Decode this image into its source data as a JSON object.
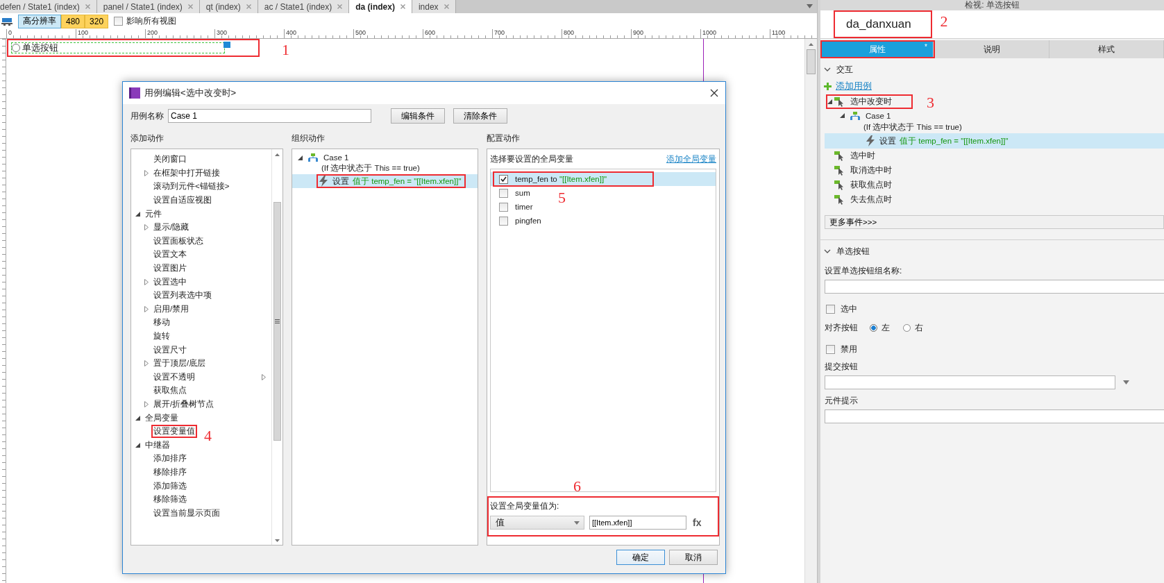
{
  "editor_tabs": [
    {
      "label": "defen / State1 (index)",
      "selected": false
    },
    {
      "label": "panel / State1 (index)",
      "selected": false
    },
    {
      "label": "qt (index)",
      "selected": false
    },
    {
      "label": "ac / State1 (index)",
      "selected": false
    },
    {
      "label": "da (index)",
      "selected": true
    },
    {
      "label": "index",
      "selected": false
    }
  ],
  "toolbar": {
    "views": [
      {
        "label": "高分辨率",
        "kind": "base",
        "selected": true
      },
      {
        "label": "480",
        "kind": "breakpoint",
        "selected": false
      },
      {
        "label": "320",
        "kind": "breakpoint",
        "selected": false
      }
    ],
    "affect_all": {
      "label": "影响所有视图",
      "checked": false
    }
  },
  "ruler": {
    "labels": [
      "0",
      "100",
      "200",
      "300",
      "400",
      "500",
      "600",
      "700",
      "800",
      "900",
      "1000",
      "1100"
    ]
  },
  "canvas": {
    "widget": {
      "label": "单选按钮",
      "selected": false,
      "callout": "1"
    }
  },
  "dialog": {
    "title": "用例编辑<选中改变时>",
    "case_name": {
      "label": "用例名称",
      "value": "Case 1"
    },
    "buttons": [
      "编辑条件",
      "清除条件"
    ],
    "add_actions": {
      "heading": "添加动作",
      "tree": [
        {
          "children": [
            {
              "label": "关闭窗口"
            },
            {
              "label": "在框架中打开链接",
              "expanded": false
            },
            {
              "label": "滚动到元件<锚链接>"
            },
            {
              "label": "设置自适应视图"
            }
          ]
        },
        {
          "label": "元件",
          "expanded": true,
          "children": [
            {
              "label": "显示/隐藏",
              "expanded": false
            },
            {
              "label": "设置面板状态"
            },
            {
              "label": "设置文本"
            },
            {
              "label": "设置图片"
            },
            {
              "label": "设置选中",
              "expanded": false
            },
            {
              "label": "设置列表选中项"
            },
            {
              "label": "启用/禁用",
              "expanded": false
            },
            {
              "label": "移动"
            },
            {
              "label": "旋转"
            },
            {
              "label": "设置尺寸"
            },
            {
              "label": "置于顶层/底层",
              "expanded": false
            },
            {
              "label": "设置不透明",
              "submenu": true
            },
            {
              "label": "获取焦点"
            },
            {
              "label": "展开/折叠树节点",
              "expanded": false
            }
          ]
        },
        {
          "label": "全局变量",
          "expanded": true,
          "children": [
            {
              "label": "设置变量值",
              "callout": "4"
            }
          ]
        },
        {
          "label": "中继器",
          "expanded": true,
          "children": [
            {
              "label": "添加排序"
            },
            {
              "label": "移除排序"
            },
            {
              "label": "添加筛选"
            },
            {
              "label": "移除筛选"
            },
            {
              "label": "设置当前显示页面"
            }
          ]
        }
      ]
    },
    "organize": {
      "heading": "组织动作",
      "cases": [
        {
          "label": "Case 1",
          "condition": "(If 选中状态于 This == true)",
          "expanded": true,
          "actions": [
            {
              "verb": "设置",
              "detail": "值于 temp_fen = \"[[Item.xfen]]\"",
              "selected": true,
              "boxed": true
            }
          ]
        }
      ]
    },
    "configure": {
      "heading": "配置动作",
      "prompt": "选择要设置的全局变量",
      "add_link": "添加全局变量",
      "variables": [
        {
          "name": "temp_fen to",
          "value": "\"[[Item.xfen]]\"",
          "checked": true,
          "selected": true,
          "callout": "5"
        },
        {
          "name": "sum",
          "checked": false,
          "selected": false
        },
        {
          "name": "timer",
          "checked": false,
          "selected": false
        },
        {
          "name": "pingfen",
          "checked": false,
          "selected": false
        }
      ],
      "value_section": {
        "label": "设置全局变量值为:",
        "type": "值",
        "value": "[[Item.xfen]]",
        "fx": "fx",
        "callout": "6"
      }
    },
    "footer_buttons": [
      {
        "label": "确定",
        "kind": "primary"
      },
      {
        "label": "取消",
        "kind": "normal"
      }
    ]
  },
  "inspector": {
    "title": "检视: 单选按钮",
    "name": {
      "value": "da_danxuan",
      "callout": "2"
    },
    "tabs": [
      {
        "label": "属性",
        "selected": true,
        "marker": "*",
        "boxed": true
      },
      {
        "label": "说明",
        "selected": false
      },
      {
        "label": "样式",
        "selected": false
      }
    ],
    "interaction": {
      "heading": "交互",
      "expanded": true,
      "add_case": "添加用例",
      "events": [
        {
          "label": "选中改变时",
          "expanded": true,
          "callout": "3",
          "cases": [
            {
              "label": "Case 1",
              "condition": "(If 选中状态于 This == true)",
              "expanded": true,
              "actions": [
                {
                  "verb": "设置",
                  "detail": "值于 temp_fen = \"[[Item.xfen]]\"",
                  "selected": true
                }
              ]
            }
          ]
        },
        {
          "label": "选中时"
        },
        {
          "label": "取消选中时"
        },
        {
          "label": "获取焦点时"
        },
        {
          "label": "失去焦点时"
        }
      ],
      "more_events": "更多事件>>>"
    },
    "radio_section": {
      "heading": "单选按钮",
      "expanded": true,
      "group_label": "设置单选按钮组名称:",
      "selected_option": {
        "label": "选中",
        "checked": false
      },
      "align": {
        "label": "对齐按钮",
        "options": [
          {
            "label": "左",
            "selected": true
          },
          {
            "label": "右",
            "selected": false
          }
        ]
      },
      "disabled_option": {
        "label": "禁用",
        "checked": false
      },
      "submit_label": "提交按钮",
      "tooltip_label": "元件提示"
    }
  }
}
